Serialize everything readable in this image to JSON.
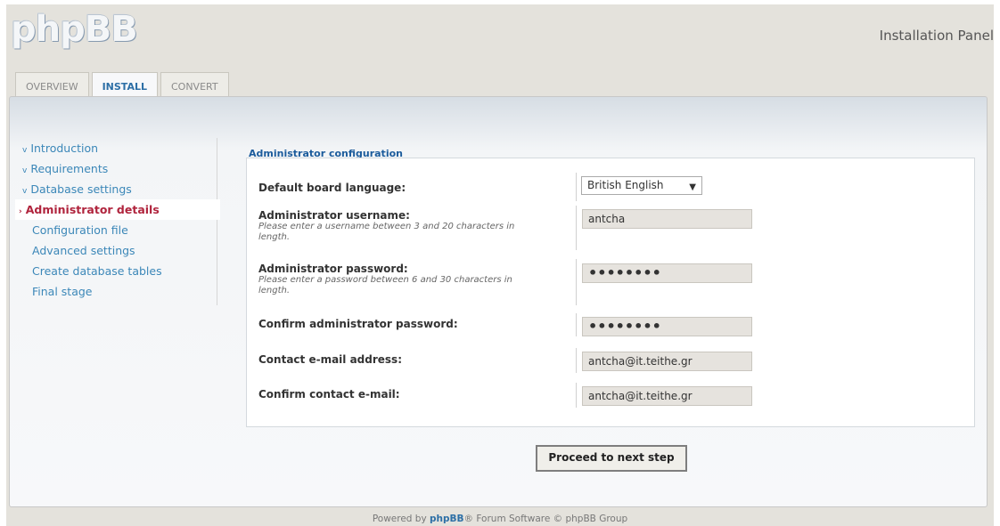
{
  "header": {
    "logo_text": "phpBB",
    "panel_title": "Installation Panel"
  },
  "tabs": [
    {
      "label": "OVERVIEW",
      "active": false
    },
    {
      "label": "INSTALL",
      "active": true
    },
    {
      "label": "CONVERT",
      "active": false
    }
  ],
  "sidebar": {
    "items": [
      {
        "label": "Introduction",
        "state": "done"
      },
      {
        "label": "Requirements",
        "state": "done"
      },
      {
        "label": "Database settings",
        "state": "done"
      },
      {
        "label": "Administrator details",
        "state": "active"
      },
      {
        "label": "Configuration file",
        "state": "pending"
      },
      {
        "label": "Advanced settings",
        "state": "pending"
      },
      {
        "label": "Create database tables",
        "state": "pending"
      },
      {
        "label": "Final stage",
        "state": "pending"
      }
    ],
    "done_marker": "»",
    "active_marker": "›"
  },
  "form": {
    "title": "Administrator configuration",
    "language": {
      "label": "Default board language:",
      "value": "British English"
    },
    "username": {
      "label": "Administrator username:",
      "help": "Please enter a username between 3 and 20 characters in length.",
      "value": "antcha"
    },
    "password": {
      "label": "Administrator password:",
      "help": "Please enter a password between 6 and 30 characters in length.",
      "value": "••••••••"
    },
    "confirm_password": {
      "label": "Confirm administrator password:",
      "value": "••••••••"
    },
    "email": {
      "label": "Contact e-mail address:",
      "value": "antcha@it.teithe.gr"
    },
    "confirm_email": {
      "label": "Confirm contact e-mail:",
      "value": "antcha@it.teithe.gr"
    }
  },
  "submit_label": "Proceed to next step",
  "footer": {
    "prefix": "Powered by ",
    "brand": "phpBB",
    "suffix": "® Forum Software © phpBB Group"
  }
}
